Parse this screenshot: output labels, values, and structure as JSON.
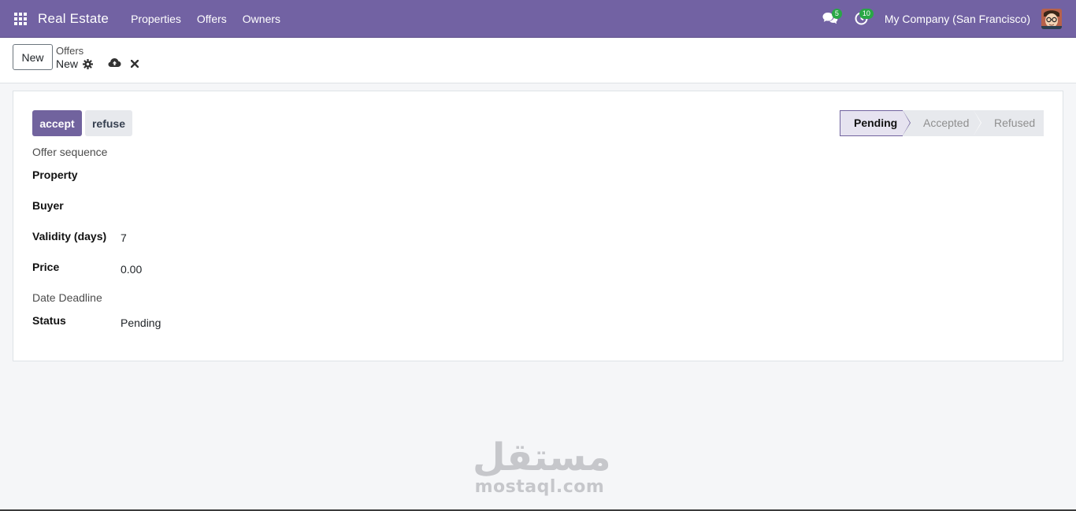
{
  "navbar": {
    "app_name": "Real Estate",
    "menu": [
      "Properties",
      "Offers",
      "Owners"
    ],
    "messages_count": "5",
    "activities_count": "10",
    "company": "My Company (San Francisco)",
    "color": "#7262a3"
  },
  "control_panel": {
    "new_button": "New",
    "breadcrumb_parent": "Offers",
    "breadcrumb_current": "New"
  },
  "form": {
    "buttons": {
      "accept": "accept",
      "refuse": "refuse"
    },
    "statusbar": [
      "Pending",
      "Accepted",
      "Refused"
    ],
    "active_stage": "Pending",
    "fields": {
      "sequence_label": "Offer sequence",
      "property_label": "Property",
      "buyer_label": "Buyer",
      "validity_label": "Validity (days)",
      "validity_value": "7",
      "price_label": "Price",
      "price_value": "0.00",
      "deadline_label": "Date Deadline",
      "status_label": "Status",
      "status_value": "Pending"
    }
  },
  "watermark": {
    "arabic": "مستقل",
    "latin": "mostaql.com"
  }
}
